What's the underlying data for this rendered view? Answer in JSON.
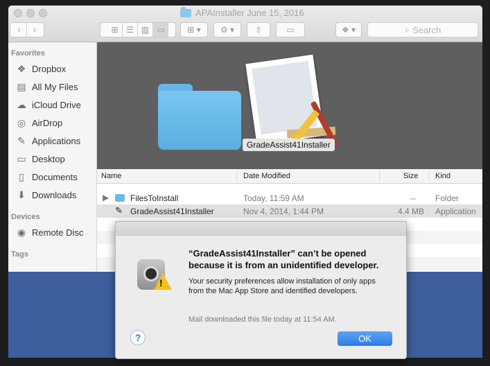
{
  "window": {
    "title": "APAInstaller June 15, 2016"
  },
  "toolbar": {
    "search_placeholder": "Search"
  },
  "sidebar": {
    "favorites_heading": "Favorites",
    "favorites": [
      {
        "label": "Dropbox",
        "icon": "dropbox-icon"
      },
      {
        "label": "All My Files",
        "icon": "all-files-icon"
      },
      {
        "label": "iCloud Drive",
        "icon": "cloud-icon"
      },
      {
        "label": "AirDrop",
        "icon": "airdrop-icon"
      },
      {
        "label": "Applications",
        "icon": "applications-icon"
      },
      {
        "label": "Desktop",
        "icon": "desktop-icon"
      },
      {
        "label": "Documents",
        "icon": "documents-icon"
      },
      {
        "label": "Downloads",
        "icon": "downloads-icon"
      }
    ],
    "devices_heading": "Devices",
    "devices": [
      {
        "label": "Remote Disc",
        "icon": "disc-icon"
      }
    ],
    "tags_heading": "Tags"
  },
  "gallery": {
    "selected_label": "GradeAssist41Installer"
  },
  "list": {
    "headers": {
      "name": "Name",
      "date": "Date Modified",
      "size": "Size",
      "kind": "Kind"
    },
    "rows": [
      {
        "name": "FilesToInstall",
        "date": "Today, 11:59 AM",
        "size": "--",
        "kind": "Folder"
      },
      {
        "name": "GradeAssist41Installer",
        "date": "Nov 4, 2014, 1:44 PM",
        "size": "4.4 MB",
        "kind": "Application"
      }
    ]
  },
  "dialog": {
    "title": "“GradeAssist41Installer” can’t be opened because it is from an unidentified developer.",
    "body": "Your security preferences allow installation of only apps from the Mac App Store and identified developers.",
    "note": "Mail downloaded this file today at 11:54 AM.",
    "help_label": "?",
    "ok_label": "OK"
  },
  "colors": {
    "desktop": "#3d5f9e",
    "accent": "#2f7ae8",
    "warning": "#f0c21b"
  }
}
